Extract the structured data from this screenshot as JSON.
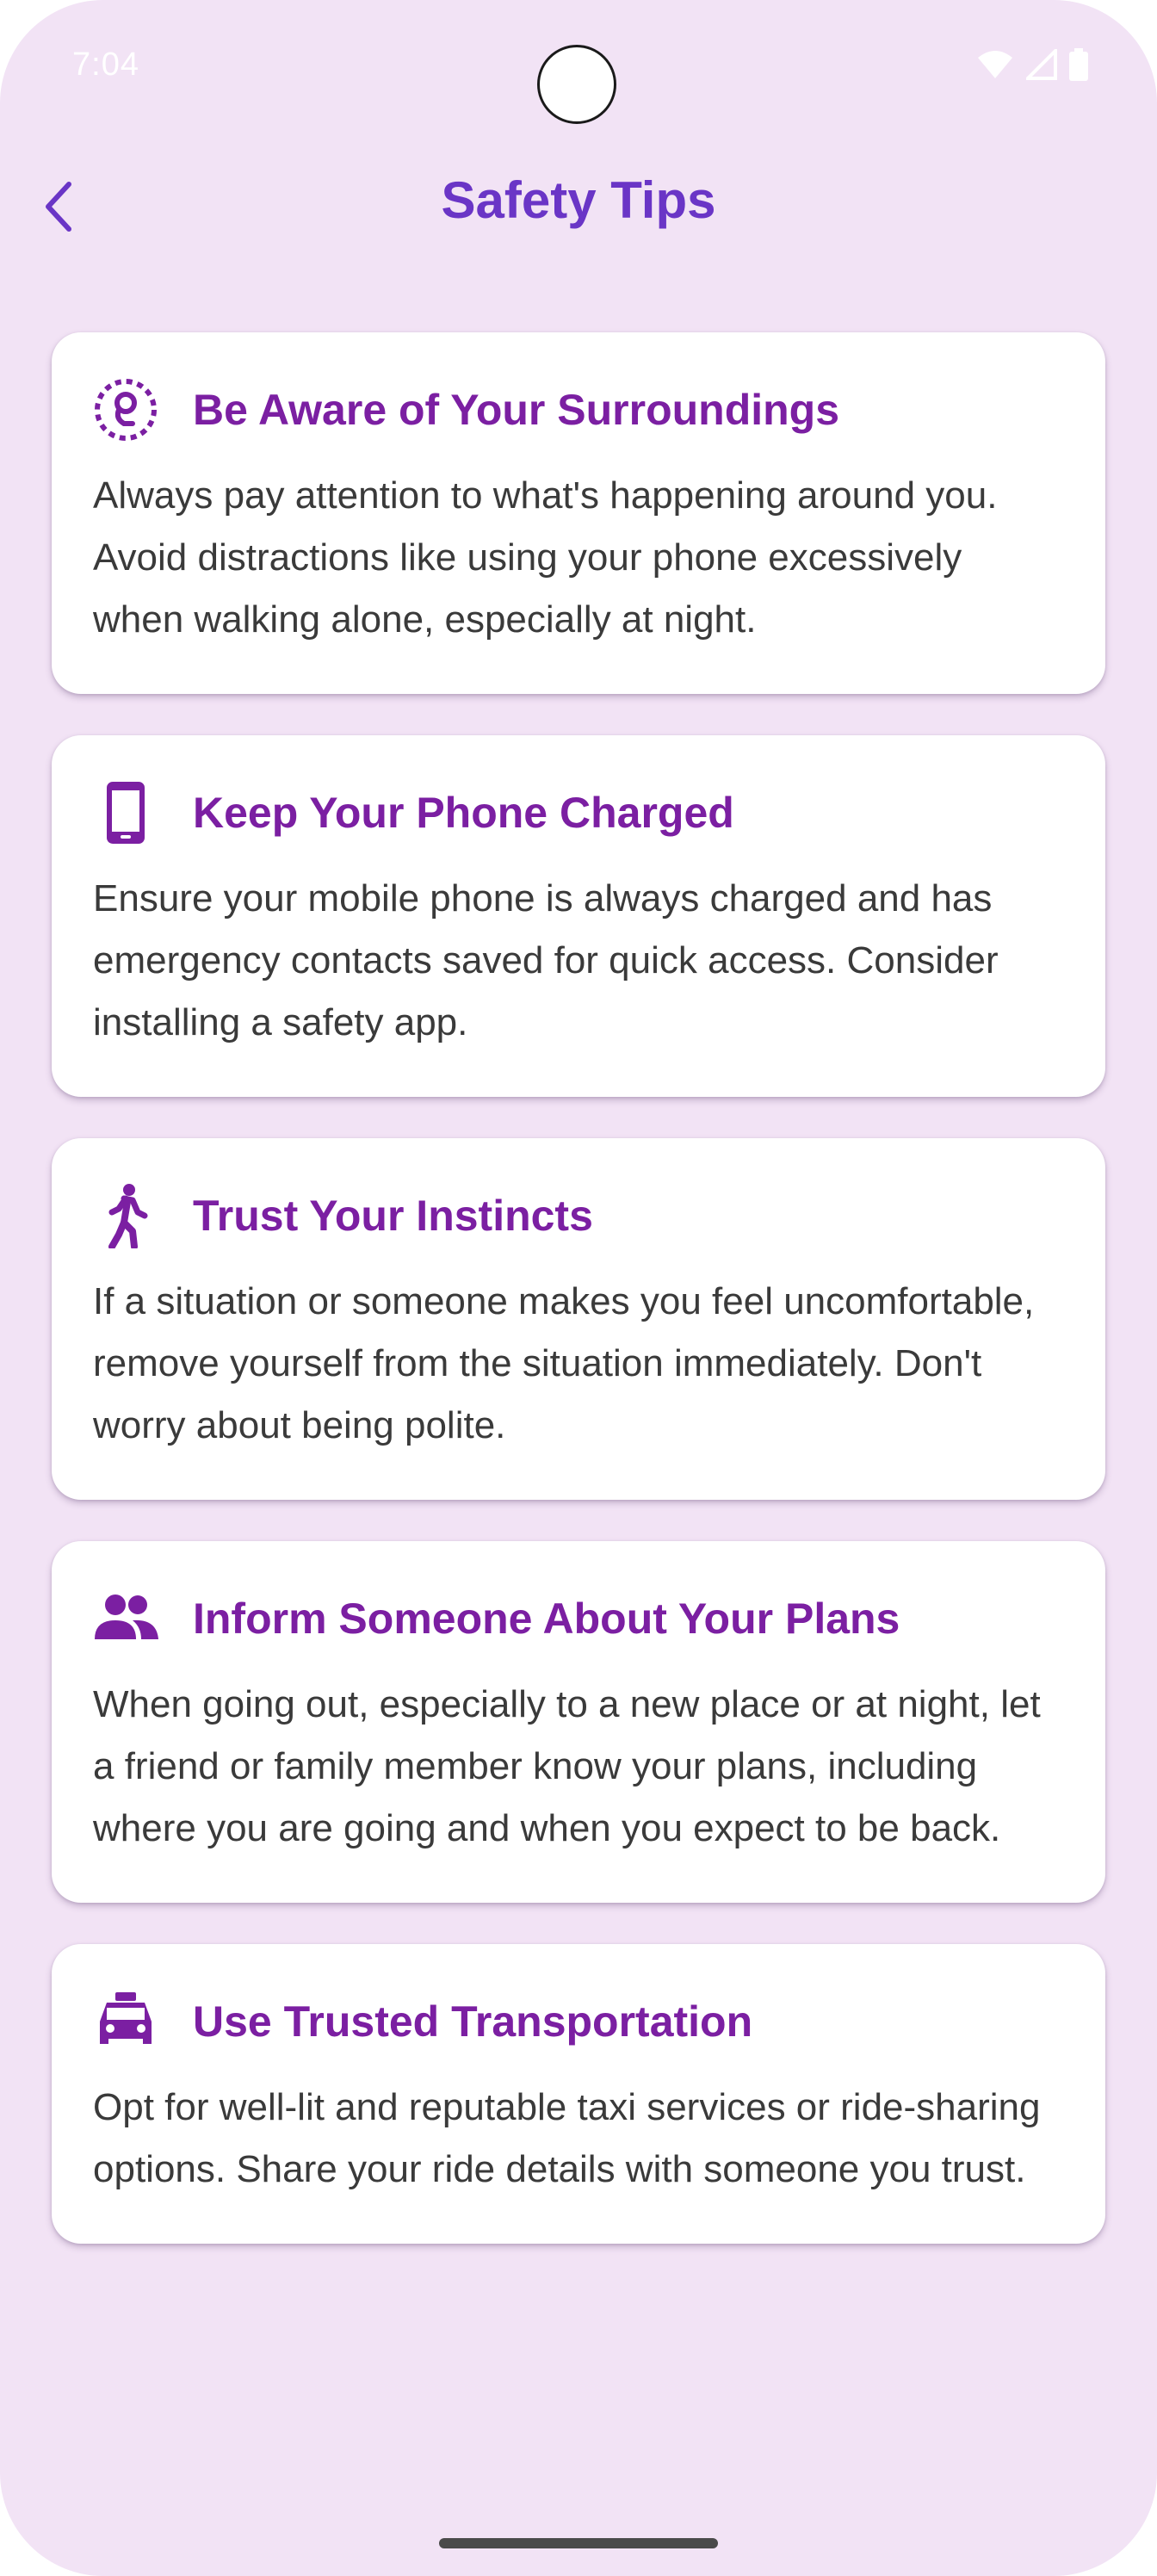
{
  "status_bar": {
    "time": "7:04"
  },
  "app_bar": {
    "title": "Safety Tips",
    "back_icon": "chevron-left-icon"
  },
  "colors": {
    "background": "#f2e3f5",
    "title": "#6a35c6",
    "card_title": "#7b1fa2",
    "body_text": "#3a3a3a",
    "card": "#ffffff"
  },
  "tips": [
    {
      "icon": "surroundings-icon",
      "title": "Be Aware of Your Surroundings",
      "body": "Always pay attention to what's happening around you. Avoid distractions like using your phone excessively when walking alone, especially at night."
    },
    {
      "icon": "phone-icon",
      "title": "Keep Your Phone Charged",
      "body": "Ensure your mobile phone is always charged and has emergency contacts saved for quick access. Consider installing a safety app."
    },
    {
      "icon": "walking-person-icon",
      "title": "Trust Your Instincts",
      "body": "If a situation or someone makes you feel uncomfortable, remove yourself from the situation immediately. Don't worry about being polite."
    },
    {
      "icon": "people-icon",
      "title": "Inform Someone About Your Plans",
      "body": "When going out, especially to a new place or at night, let a friend or family member know your plans, including where you are going and when you expect to be back."
    },
    {
      "icon": "taxi-icon",
      "title": "Use Trusted Transportation",
      "body": "Opt for well-lit and reputable taxi services or ride-sharing options. Share your ride details with someone you trust."
    }
  ]
}
